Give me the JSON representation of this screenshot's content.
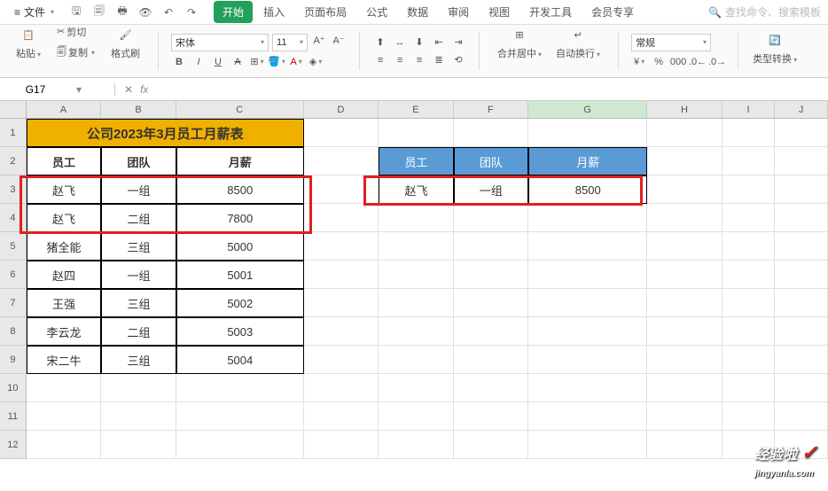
{
  "menubar": {
    "file": "文件",
    "tabs": [
      "开始",
      "插入",
      "页面布局",
      "公式",
      "数据",
      "审阅",
      "视图",
      "开发工具",
      "会员专享"
    ],
    "active_tab": 0,
    "search_placeholder": "查找命令、搜索模板"
  },
  "ribbon": {
    "paste": "粘贴",
    "cut": "剪切",
    "copy": "复制",
    "format_painter": "格式刷",
    "font_name": "宋体",
    "font_size": "11",
    "merge": "合并居中",
    "wrap": "自动换行",
    "number_format": "常规",
    "type_convert": "类型转换"
  },
  "name_box": "G17",
  "columns": [
    "A",
    "B",
    "C",
    "D",
    "E",
    "F",
    "G",
    "H",
    "I",
    "J"
  ],
  "row_numbers": [
    "1",
    "2",
    "3",
    "4",
    "5",
    "6",
    "7",
    "8",
    "9",
    "10",
    "11",
    "12"
  ],
  "title": "公司2023年3月员工月薪表",
  "headers": [
    "员工",
    "团队",
    "月薪"
  ],
  "rows": [
    {
      "emp": "赵飞",
      "team": "一组",
      "salary": "8500"
    },
    {
      "emp": "赵飞",
      "team": "二组",
      "salary": "7800"
    },
    {
      "emp": "猪全能",
      "team": "三组",
      "salary": "5000"
    },
    {
      "emp": "赵四",
      "team": "一组",
      "salary": "5001"
    },
    {
      "emp": "王强",
      "team": "三组",
      "salary": "5002"
    },
    {
      "emp": "李云龙",
      "team": "二组",
      "salary": "5003"
    },
    {
      "emp": "宋二牛",
      "team": "三组",
      "salary": "5004"
    }
  ],
  "lookup_headers": [
    "员工",
    "团队",
    "月薪"
  ],
  "lookup_row": {
    "emp": "赵飞",
    "team": "一组",
    "salary": "8500"
  },
  "watermark": {
    "main": "经验啦",
    "sub": "jingyanla.com"
  }
}
